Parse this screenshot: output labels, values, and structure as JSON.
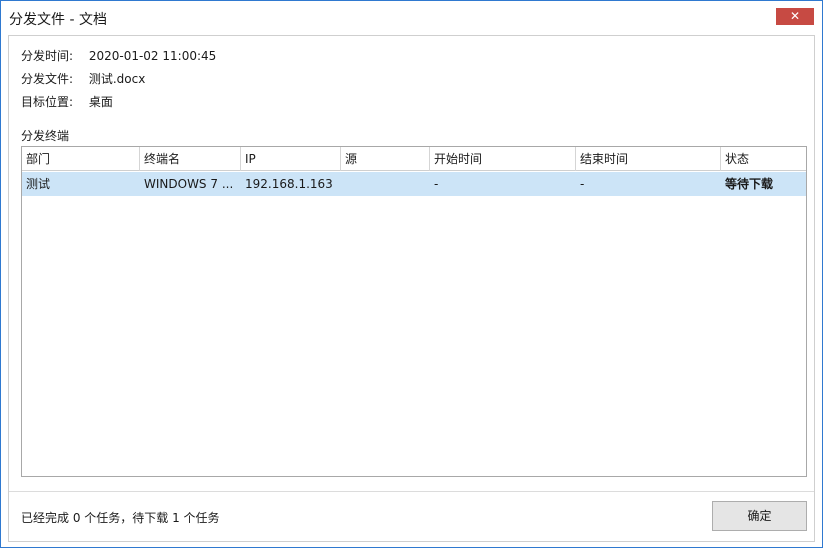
{
  "window": {
    "title": "分发文件 - 文档",
    "close_label": "✕"
  },
  "info": {
    "time_label": "分发时间:",
    "time_value": "2020-01-02 11:00:45",
    "file_label": "分发文件:",
    "file_value": "测试.docx",
    "target_label": "目标位置:",
    "target_value": "桌面"
  },
  "section": {
    "title": "分发终端"
  },
  "table": {
    "columns": [
      "部门",
      "终端名",
      "IP",
      "源",
      "开始时间",
      "结束时间",
      "状态"
    ],
    "rows": [
      {
        "department": "测试",
        "terminal": "WINDOWS 7 ...",
        "ip": "192.168.1.163",
        "source": "",
        "start": "-",
        "end": "-",
        "status": "等待下载"
      }
    ]
  },
  "footer": {
    "summary": "已经完成 0 个任务，待下载 1 个任务",
    "ok_label": "确定"
  },
  "colors": {
    "selected_row": "#cce4f7",
    "close_button": "#c74a43",
    "window_border": "#2f79d0"
  }
}
